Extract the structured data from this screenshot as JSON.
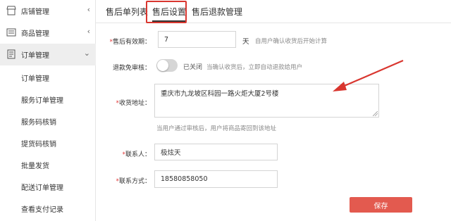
{
  "sidebar": {
    "items": [
      {
        "label": "店铺管理",
        "icon": "store-icon",
        "arrow": "‹"
      },
      {
        "label": "商品管理",
        "icon": "product-list-icon",
        "arrow": "‹"
      },
      {
        "label": "订单管理",
        "icon": "order-document-icon",
        "arrow": "⌄"
      }
    ],
    "sub_items": [
      "订单管理",
      "服务订单管理",
      "服务码核销",
      "提货码核销",
      "批量发货",
      "配送订单管理",
      "查看支付记录"
    ]
  },
  "tabs": [
    {
      "label": "售后单列表"
    },
    {
      "label": "售后设置"
    },
    {
      "label": "售后退款管理"
    }
  ],
  "form": {
    "validity": {
      "required_mark": "*",
      "label": "售后有效期：",
      "value": "7",
      "unit": "天",
      "hint": "自用户确认收货后开始计算"
    },
    "auto_review": {
      "label": "退款免审核：",
      "state_text": "已关闭",
      "hint": "当确认收货后，立即自动退款给用户"
    },
    "address": {
      "required_mark": "*",
      "label": "收货地址：",
      "value": "重庆市九龙坡区科园一路火炬大厦2号楼",
      "hint": "当用户通过审核后，用户将商品寄回到该地址"
    },
    "contact": {
      "required_mark": "*",
      "label": "联系人：",
      "value": "极炫天"
    },
    "phone": {
      "required_mark": "*",
      "label": "联系方式：",
      "value": "18580858050"
    }
  },
  "save_label": "保存",
  "colors": {
    "accent_red": "#e35a4f",
    "highlight_border": "#d9362f",
    "required": "#e23b3b"
  }
}
